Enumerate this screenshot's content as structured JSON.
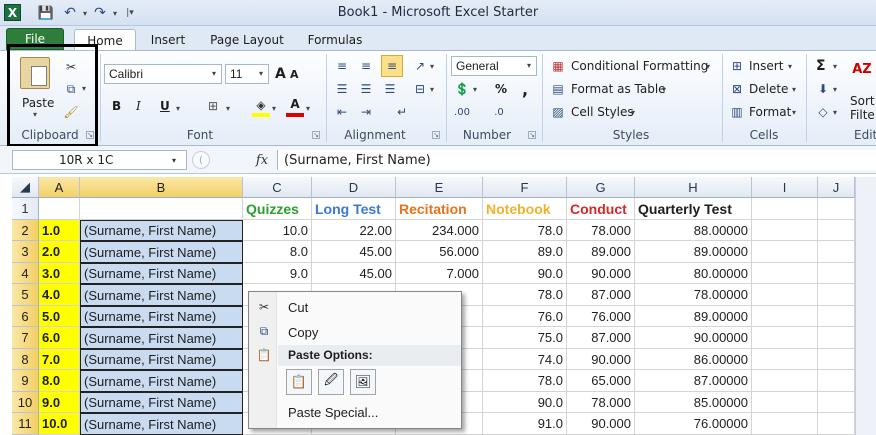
{
  "window": {
    "title": "Book1  -  Microsoft Excel Starter",
    "app_icon": "X"
  },
  "qat": {
    "save_icon": "💾",
    "undo_icon": "↶",
    "redo_icon": "↷",
    "dropdown": "▾",
    "customize": "|▾"
  },
  "tabs": {
    "file": "File",
    "home": "Home",
    "insert": "Insert",
    "page_layout": "Page Layout",
    "formulas": "Formulas"
  },
  "ribbon": {
    "clipboard": {
      "label": "Clipboard",
      "paste": "Paste"
    },
    "font": {
      "label": "Font",
      "name": "Calibri",
      "size": "11",
      "grow": "A",
      "shrink": "A",
      "bold": "B",
      "italic": "I",
      "underline": "U"
    },
    "alignment": {
      "label": "Alignment"
    },
    "number": {
      "label": "Number",
      "format": "General",
      "percent": "%",
      "comma": ","
    },
    "styles": {
      "label": "Styles",
      "conditional": "Conditional Formatting",
      "format_table": "Format as Table",
      "cell_styles": "Cell Styles"
    },
    "cells": {
      "label": "Cells",
      "insert": "Insert",
      "delete": "Delete",
      "format": "Format"
    },
    "editing": {
      "label": "Edit",
      "sort": "Sort",
      "filter": "Filte",
      "sigma": "Σ"
    }
  },
  "formula_bar": {
    "name_box": "10R x 1C",
    "fx": "fx",
    "value": "(Surname, First Name)"
  },
  "grid": {
    "columns": [
      "A",
      "B",
      "C",
      "D",
      "E",
      "F",
      "G",
      "H",
      "I",
      "J"
    ],
    "header_row": {
      "c": "Quizzes",
      "d": "Long Test",
      "e": "Recitation",
      "f": "Notebook",
      "g": "Conduct",
      "h": "Quarterly Test"
    },
    "header_colors": {
      "c": "#2ca02c",
      "d": "#3a78d8",
      "e": "#e8731c",
      "f": "#f2b12b",
      "g": "#d62728",
      "h": "#1e1e1e"
    },
    "rows": [
      {
        "n": "1",
        "a": "",
        "b": "",
        "c": "",
        "d": "",
        "e": "",
        "f": "",
        "g": "",
        "h": ""
      },
      {
        "n": "2",
        "a": "1.0",
        "b": "(Surname, First Name)",
        "c": "10.0",
        "d": "22.00",
        "e": "234.000",
        "f": "78.0",
        "g": "78.000",
        "h": "88.00000"
      },
      {
        "n": "3",
        "a": "2.0",
        "b": "(Surname, First Name)",
        "c": "8.0",
        "d": "45.00",
        "e": "56.000",
        "f": "89.0",
        "g": "89.000",
        "h": "89.00000"
      },
      {
        "n": "4",
        "a": "3.0",
        "b": "(Surname, First Name)",
        "c": "9.0",
        "d": "45.00",
        "e": "7.000",
        "f": "90.0",
        "g": "90.000",
        "h": "80.00000"
      },
      {
        "n": "5",
        "a": "4.0",
        "b": "(Surname, First Name)",
        "c": "",
        "d": "",
        "e": "",
        "f": "78.0",
        "g": "87.000",
        "h": "78.00000"
      },
      {
        "n": "6",
        "a": "5.0",
        "b": "(Surname, First Name)",
        "c": "",
        "d": "",
        "e": "",
        "f": "76.0",
        "g": "76.000",
        "h": "89.00000"
      },
      {
        "n": "7",
        "a": "6.0",
        "b": "(Surname, First Name)",
        "c": "",
        "d": "",
        "e": "",
        "f": "75.0",
        "g": "87.000",
        "h": "90.00000"
      },
      {
        "n": "8",
        "a": "7.0",
        "b": "(Surname, First Name)",
        "c": "",
        "d": "",
        "e": "",
        "f": "74.0",
        "g": "90.000",
        "h": "86.00000"
      },
      {
        "n": "9",
        "a": "8.0",
        "b": "(Surname, First Name)",
        "c": "",
        "d": "",
        "e": "",
        "f": "78.0",
        "g": "65.000",
        "h": "87.00000"
      },
      {
        "n": "10",
        "a": "9.0",
        "b": "(Surname, First Name)",
        "c": "",
        "d": "",
        "e": "",
        "f": "90.0",
        "g": "78.000",
        "h": "85.00000"
      },
      {
        "n": "11",
        "a": "10.0",
        "b": "(Surname, First Name)",
        "c": "",
        "d": "",
        "e": "",
        "f": "91.0",
        "g": "90.000",
        "h": "76.00000"
      }
    ]
  },
  "context_menu": {
    "cut": "Cut",
    "copy": "Copy",
    "paste_options": "Paste Options:",
    "paste_special": "Paste Special..."
  }
}
